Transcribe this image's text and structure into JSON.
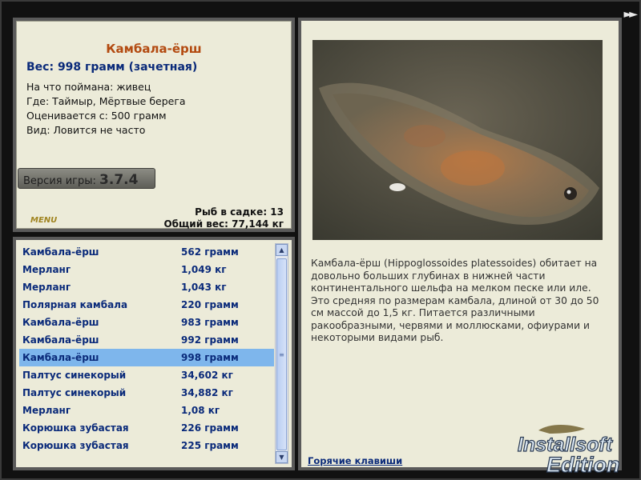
{
  "nav": {
    "next_icon": "double-arrow-right"
  },
  "fish": {
    "name": "Камбала-ёрш",
    "weight_line": "Вес: 998 грамм (зачетная)",
    "caught_on": "На что поймана: живец",
    "location": "Где: Таймыр, Мёртвые берега",
    "valued_from": "Оценивается с: 500 грамм",
    "kind": "Вид: Ловится не часто"
  },
  "version": {
    "label": "Версия игры: ",
    "number": "3.7.4"
  },
  "logo_small": "MENU",
  "stats": {
    "fish_count": "Рыб в садке: 13",
    "total_weight": "Общий вес: 77,144 кг"
  },
  "catch_list": [
    {
      "name": "Камбала-ёрш",
      "weight": "562 грамм",
      "selected": false
    },
    {
      "name": "Мерланг",
      "weight": "1,049 кг",
      "selected": false
    },
    {
      "name": "Мерланг",
      "weight": "1,043 кг",
      "selected": false
    },
    {
      "name": "Полярная камбала",
      "weight": "220 грамм",
      "selected": false
    },
    {
      "name": "Камбала-ёрш",
      "weight": "983 грамм",
      "selected": false
    },
    {
      "name": "Камбала-ёрш",
      "weight": "992 грамм",
      "selected": false
    },
    {
      "name": "Камбала-ёрш",
      "weight": "998 грамм",
      "selected": true
    },
    {
      "name": "Палтус синекорый",
      "weight": "34,602 кг",
      "selected": false
    },
    {
      "name": "Палтус синекорый",
      "weight": "34,882 кг",
      "selected": false
    },
    {
      "name": "Мерланг",
      "weight": "1,08 кг",
      "selected": false
    },
    {
      "name": "Корюшка зубастая",
      "weight": "226 грамм",
      "selected": false
    },
    {
      "name": "Корюшка зубастая",
      "weight": "225 грамм",
      "selected": false
    }
  ],
  "description": "Камбала-ёрш (Hippoglossoides platessoides) обитает на довольно больших глубинах в нижней части континентального шельфа на мелком песке или иле. Это средняя по размерам камбала, длиной от 30 до 50 см массой до 1,5 кг. Питается различными ракообразными, червями и моллюсками, офиурами и некоторыми видами рыб.",
  "hotkeys_link": "Горячие клавиши",
  "watermark": {
    "line1": "Installsoft",
    "line2": "Edition"
  },
  "colors": {
    "panel_bg": "#ecebd9",
    "title_orange": "#b34a10",
    "text_blue": "#0a2a7a",
    "selection": "#7eb6ec"
  }
}
